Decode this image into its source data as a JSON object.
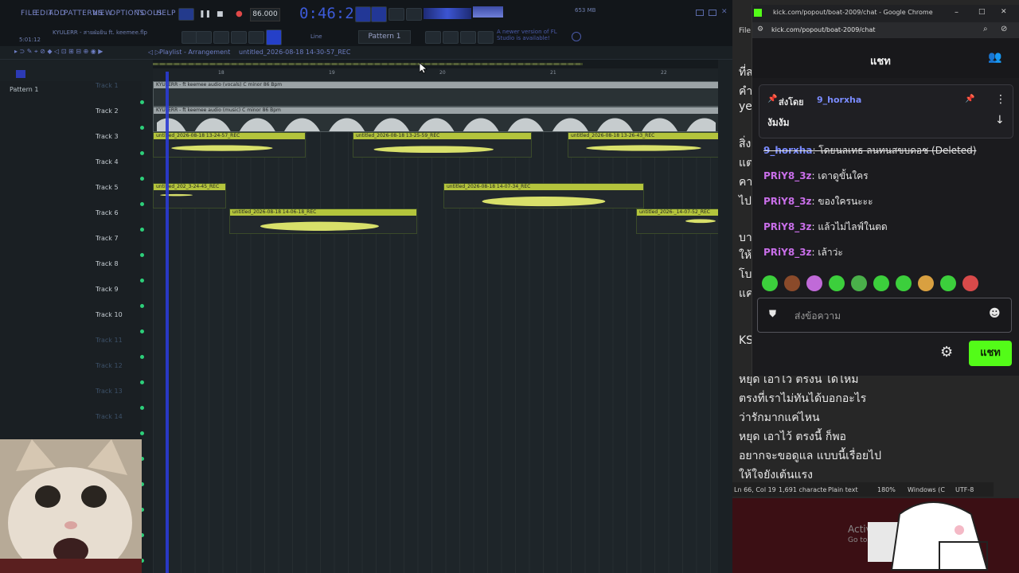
{
  "fl": {
    "menu": [
      "FILE",
      "EDIT",
      "ADD",
      "PATTERNS",
      "VIEW",
      "OPTIONS",
      "TOOLS",
      "HELP"
    ],
    "tempo": "86.000",
    "time": "0:46:21",
    "pattern": "Pattern 1",
    "hint_title": "KYULERR - สายฝ่อยิน ft. keemee.flp",
    "hint_time": "5:01:12",
    "memory": "653 MB",
    "notice": "A newer version of FL Studio is available!",
    "playlist_title": "Playlist - Arrangement",
    "playlist_crumb": "untitled_2026-08-18 14-30-57_REC",
    "sidebar_pattern": "Pattern 1",
    "ruler": [
      "18",
      "19",
      "20",
      "21",
      "22"
    ],
    "tracks": [
      "Track 1",
      "Track 2",
      "Track 3",
      "Track 4",
      "Track 5",
      "Track 6",
      "Track 7",
      "Track 8",
      "Track 9",
      "Track 10",
      "Track 11",
      "Track 12",
      "Track 13",
      "Track 14"
    ],
    "clips": {
      "t1": "KYULERR - ft keemee audio (vocals) C minor 86 Bpm",
      "t2": "KYULERR - ft keemee audio (music) C minor 86 Bpm",
      "t3a": "untitled_2026-08-18 13-24-57_REC",
      "t3b": "untitled_2026-08-18 13-25-59_REC",
      "t3c": "untitled_2026-08-18 13-26-43_REC",
      "t5a": "untitled_202_3-24-45_REC",
      "t5b": "untitled_2026-08-18 14-07-34_REC",
      "t6a": "untitled_2026-08-18 14-06-18_REC",
      "t6b": "untitled_2026-_14-07-52_REC"
    }
  },
  "chrome": {
    "title": "kick.com/popout/boat-2009/chat - Google Chrome",
    "url": "kick.com/popout/boat-2009/chat",
    "chat_title": "แชท",
    "pinned_by": "ส่งโดย",
    "pinned_user": "9_horxha",
    "pinned_text": "งัมงัม",
    "deleted_line_user": "9_horxha",
    "deleted_line_text": ": โดยนลเทธ ลนทนสขบดอช (Deleted)",
    "messages": [
      {
        "user": "PRiY8_3z",
        "text": ": เดาดูขั้นใคร"
      },
      {
        "user": "PRiY8_3z",
        "text": ": ของใครนะะะ"
      },
      {
        "user": "PRiY8_3z",
        "text": ": แล้วไม่ไลฟ์ในตด"
      },
      {
        "user": "PRiY8_3z",
        "text": ": เล้าว่ะ"
      }
    ],
    "input_placeholder": "ส่งข้อความ",
    "send_label": "แชท"
  },
  "notepad": {
    "bg_snippets": [
      "ที่ส",
      "คำ",
      "ye",
      "สิ่ง",
      "แต",
      "คา",
      "ไป",
      "บา",
      "ให้",
      "โบ",
      "แค",
      "KS"
    ],
    "lines": [
      "หยุด เอาไว้ ตรงนี้ ได้ไหม",
      "ตรงที่เราไม่ทันได้บอกอะไร",
      "ว่ารักมากแค่ไหน",
      "หยุด เอาไว้ ตรงนี้ ก็พอ",
      "อยากจะขอดูแล แบบนี้เรื่อยไป",
      "ให้ใจยังเต้นแรง"
    ],
    "file_menu": "File",
    "status": {
      "pos": "Ln 66, Col 19",
      "chars": "1,691 characte",
      "type": "Plain text",
      "zoom": "180%",
      "eol": "Windows (C",
      "enc": "UTF-8"
    }
  },
  "desktop": {
    "activate_text": "Activ",
    "goto_text": "Go to"
  }
}
